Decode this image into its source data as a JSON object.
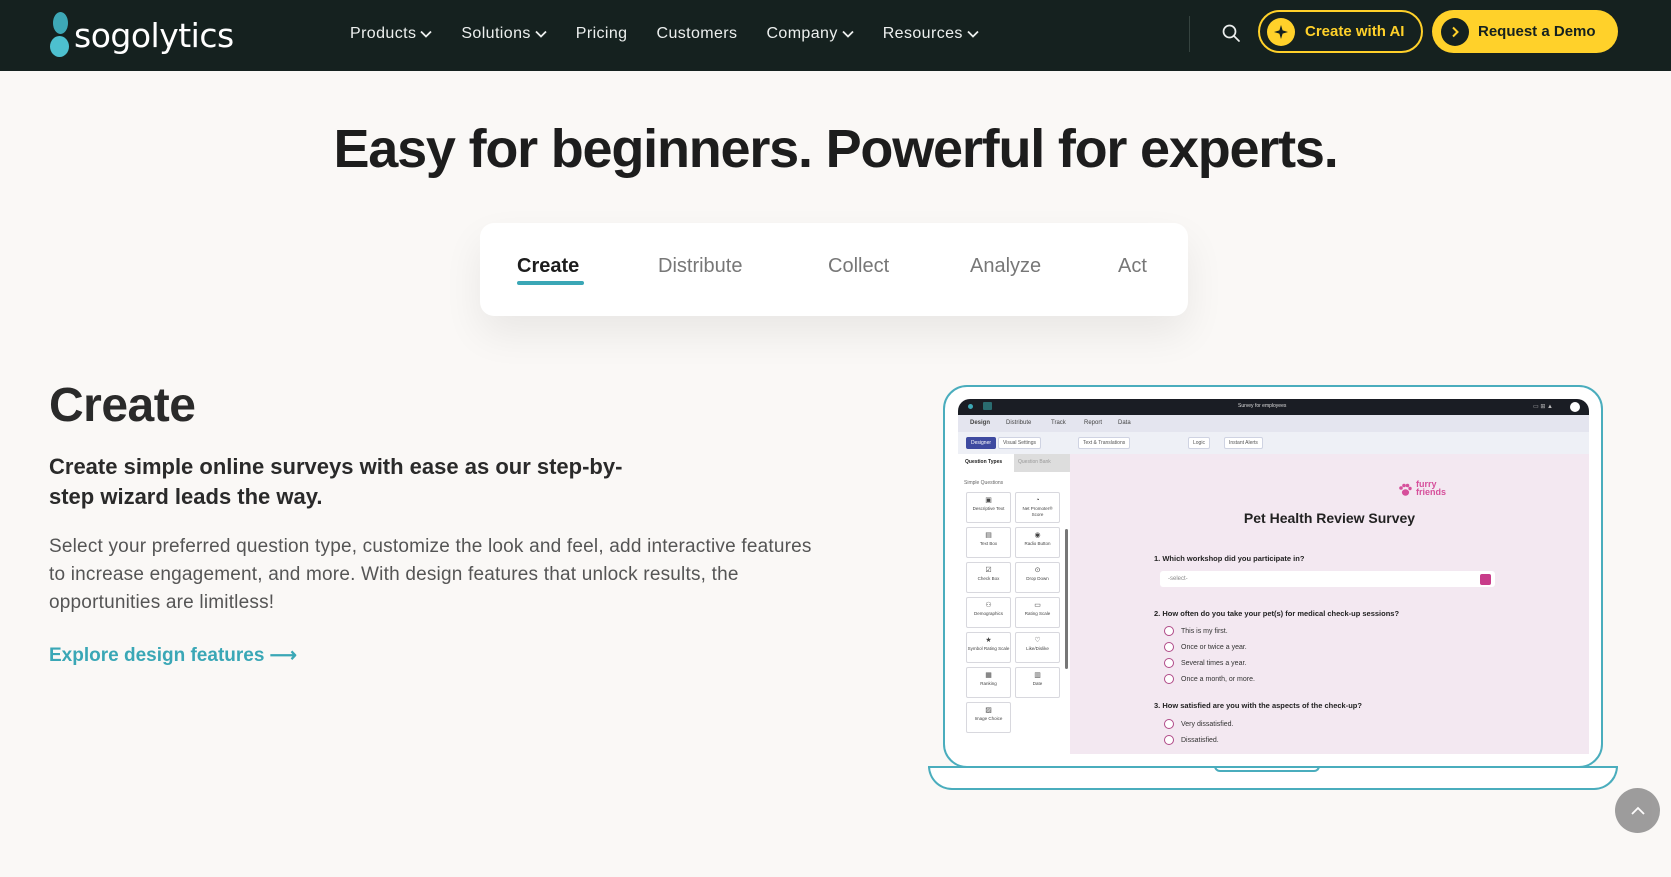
{
  "brand": {
    "name": "sogolytics"
  },
  "nav": {
    "items": [
      {
        "label": "Products",
        "has_dropdown": true
      },
      {
        "label": "Solutions",
        "has_dropdown": true
      },
      {
        "label": "Pricing",
        "has_dropdown": false
      },
      {
        "label": "Customers",
        "has_dropdown": false
      },
      {
        "label": "Company",
        "has_dropdown": true
      },
      {
        "label": "Resources",
        "has_dropdown": true
      }
    ],
    "search_icon": "search-icon",
    "ai_button": "Create with AI",
    "demo_button": "Request a Demo"
  },
  "hero": {
    "title": "Easy for beginners. Powerful for experts."
  },
  "tabs": {
    "items": [
      "Create",
      "Distribute",
      "Collect",
      "Analyze",
      "Act"
    ],
    "active": "Create"
  },
  "section": {
    "title": "Create",
    "subtitle": "Create simple online surveys with ease as our step-by-step wizard leads the way.",
    "body": "Select your preferred question type, customize the look and feel, add interactive features to increase engagement, and more. With design features that unlock results, the opportunities are limitless!",
    "link": "Explore design features ⟶"
  },
  "app_preview": {
    "top_label": "Survey for employees",
    "tabs": [
      "Design",
      "Distribute",
      "Track",
      "Report",
      "Data"
    ],
    "toolbar": [
      "Designer",
      "Visual Settings",
      "Text & Translations",
      "Logic",
      "Instant Alerts"
    ],
    "side_tabs": [
      "Question Types",
      "Question Bank"
    ],
    "side_group": "Simple Questions",
    "question_types": [
      "Descriptive Text",
      "Net Promoter® Score",
      "Text Box",
      "Radio Button",
      "Check Box",
      "Drop Down",
      "Demographics",
      "Rating Scale",
      "Symbol Rating Scale",
      "Like/Dislike",
      "Ranking",
      "Date",
      "Image Choice"
    ],
    "brand_name": "furry friends",
    "survey_title": "Pet Health Review Survey",
    "q1": "1. Which workshop did you participate in?",
    "select_placeholder": "-select-",
    "q2": "2. How often do you take your pet(s) for medical check-up sessions?",
    "q2_options": [
      "This is my first.",
      "Once or twice a year.",
      "Several times a year.",
      "Once a month, or more."
    ],
    "q3": "3. How satisfied are you with the aspects of the check-up?",
    "q3_options": [
      "Very dissatisfied.",
      "Dissatisfied."
    ]
  },
  "colors": {
    "nav_bg": "#15211f",
    "accent_yellow": "#ffd12a",
    "accent_teal": "#3aa7b6",
    "page_bg": "#faf8f6",
    "survey_pink": "#c83c8a"
  }
}
